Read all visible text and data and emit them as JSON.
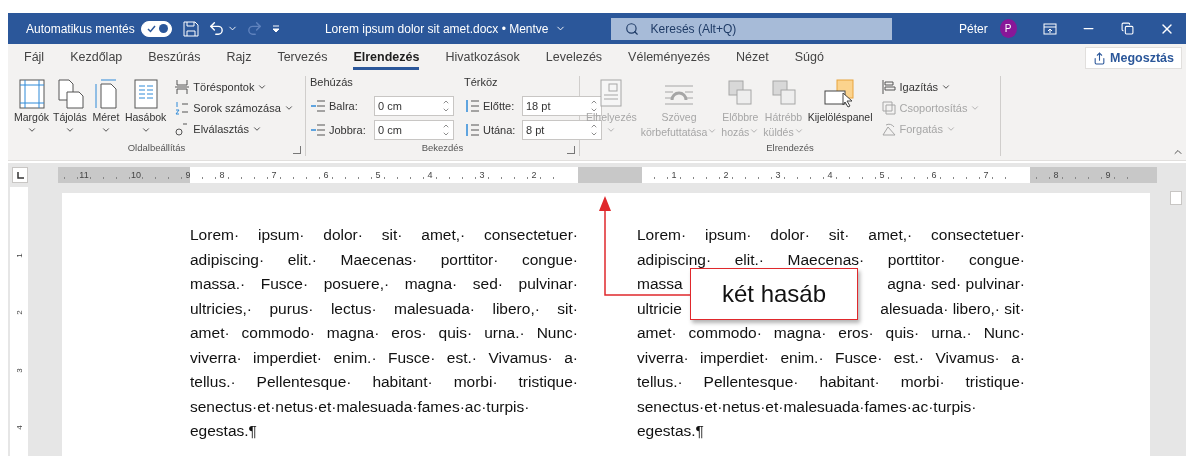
{
  "title_bar": {
    "autosave_label": "Automatikus mentés",
    "autosave_on": true,
    "redo_disabled": true,
    "document_title": "Lorem ipsum dolor sit amet.docx • Mentve",
    "search_placeholder": "Keresés (Alt+Q)",
    "user_name": "Péter",
    "avatar_initial": "P"
  },
  "tabs": [
    {
      "label": "Fájl",
      "selected": false
    },
    {
      "label": "Kezdőlap",
      "selected": false
    },
    {
      "label": "Beszúrás",
      "selected": false
    },
    {
      "label": "Rajz",
      "selected": false
    },
    {
      "label": "Tervezés",
      "selected": false
    },
    {
      "label": "Elrendezés",
      "selected": true
    },
    {
      "label": "Hivatkozások",
      "selected": false
    },
    {
      "label": "Levelezés",
      "selected": false
    },
    {
      "label": "Véleményezés",
      "selected": false
    },
    {
      "label": "Nézet",
      "selected": false
    },
    {
      "label": "Súgó",
      "selected": false
    }
  ],
  "share_button": "Megosztás",
  "page_setup": {
    "title": "Oldalbeállítás",
    "large_buttons": [
      "Margók",
      "Tájolás",
      "Méret",
      "Hasábok"
    ],
    "small_buttons": [
      "Töréspontok",
      "Sorok számozása",
      "Elválasztás"
    ]
  },
  "paragraph": {
    "title": "Bekezdés",
    "indent_heading": "Behúzás",
    "spacing_heading": "Térköz",
    "fields": [
      {
        "label": "Balra:",
        "value": "0 cm"
      },
      {
        "label": "Jobbra:",
        "value": "0 cm"
      },
      {
        "label": "Előtte:",
        "value": "18 pt"
      },
      {
        "label": "Utána:",
        "value": "8 pt"
      }
    ]
  },
  "arrange": {
    "title": "Elrendezés",
    "large_buttons": [
      {
        "lines": [
          "Elhelyezés"
        ],
        "has_menu": true,
        "disabled": true
      },
      {
        "lines": [
          "Szöveg",
          "körbefuttatása"
        ],
        "has_menu": true,
        "disabled": true
      },
      {
        "lines": [
          "Előbbre",
          "hozás"
        ],
        "has_menu": true,
        "disabled": true
      },
      {
        "lines": [
          "Hátrébb",
          "küldés"
        ],
        "has_menu": true,
        "disabled": true
      },
      {
        "lines": [
          "Kijelöléspanel"
        ],
        "has_menu": false,
        "disabled": false
      }
    ],
    "small_buttons": [
      {
        "label": "Igazítás",
        "disabled": false
      },
      {
        "label": "Csoportosítás",
        "disabled": true
      },
      {
        "label": "Forgatás",
        "disabled": true
      }
    ]
  },
  "ruler": {
    "segments": [
      {
        "kind": "margin",
        "numbers": [
          "11",
          "10",
          "9"
        ]
      },
      {
        "kind": "text",
        "numbers": [
          "8",
          "7",
          "6",
          "5",
          "4",
          "3",
          "2"
        ]
      },
      {
        "kind": "gap"
      },
      {
        "kind": "text",
        "numbers": [
          "1",
          "2",
          "3",
          "4",
          "5",
          "6",
          "7"
        ]
      },
      {
        "kind": "margin",
        "numbers": [
          "8",
          "9"
        ]
      }
    ]
  },
  "vertical_ruler": [
    "1",
    "2",
    "3",
    "4"
  ],
  "columns": [
    {
      "lines": [
        "Lorem· ipsum· dolor· sit· amet,· consectetuer·",
        "adipiscing· elit.· Maecenas· porttitor· congue·",
        "massa.· Fusce· posuere,· magna· sed· pulvinar·",
        "ultricies,· purus· lectus· malesuada· libero,· sit·",
        "amet· commodo· magna· eros· quis· urna.· Nunc·",
        "viverra· imperdiet· enim.· Fusce· est.· Vivamus· a·",
        "tellus.· Pellentesque· habitant· morbi· tristique·",
        "senectus·et·netus·et·malesuada·fames·ac·turpis·",
        "egestas.¶"
      ]
    },
    {
      "lines": [
        "Lorem· ipsum· dolor· sit· amet,· consectetuer·",
        "adipiscing· elit.· Maecenas· porttitor· congue·",
        {
          "before": "massa",
          "after": "agna· sed· pulvinar·"
        },
        {
          "before": "ultricie",
          "after": "alesuada· libero,· sit·"
        },
        "amet· commodo· magna· eros· quis· urna.· Nunc·",
        "viverra· imperdiet· enim.· Fusce· est.· Vivamus· a·",
        "tellus.· Pellentesque· habitant· morbi· tristique·",
        "senectus·et·netus·et·malesuada·fames·ac·turpis·",
        "egestas.¶"
      ]
    }
  ],
  "callout": {
    "text": "két hasáb"
  }
}
